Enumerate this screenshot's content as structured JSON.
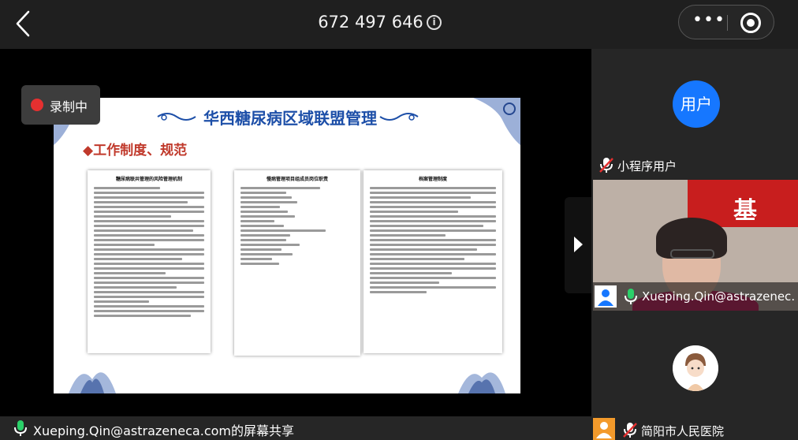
{
  "header": {
    "meeting_id": "672 497 646",
    "info_glyph": "i",
    "more_glyph": "•••"
  },
  "recording": {
    "label": "录制中"
  },
  "slide": {
    "title": "华西糖尿病区域联盟管理",
    "section": "◆工作制度、规范",
    "docs": [
      {
        "title": "糖尿病联共管理的风险管理机制"
      },
      {
        "title": "慢病管理项目组成员岗位职责"
      },
      {
        "title": "档案管理制度"
      }
    ]
  },
  "participants": [
    {
      "name": "小程序用户",
      "avatar_text": "用户",
      "mic": "muted"
    },
    {
      "name": "Xueping.Qin@astrazenec…",
      "mic": "on",
      "background_text": "基"
    },
    {
      "name": "简阳市人民医院",
      "mic": "muted"
    }
  ],
  "share_label": "Xueping.Qin@astrazeneca.com的屏幕共享",
  "colors": {
    "accent_blue": "#1677ff",
    "record_red": "#e53030",
    "slide_title": "#1d4fa8",
    "section_red": "#c0392b",
    "mic_green": "#2bd16a",
    "mic_muted": "#ffffff"
  },
  "icons": {
    "back": "chevron-left-icon",
    "more": "more-dots-icon",
    "close": "target-close-icon",
    "mic_on": "microphone-icon",
    "mic_off": "microphone-off-icon",
    "expand": "chevron-right-icon"
  }
}
